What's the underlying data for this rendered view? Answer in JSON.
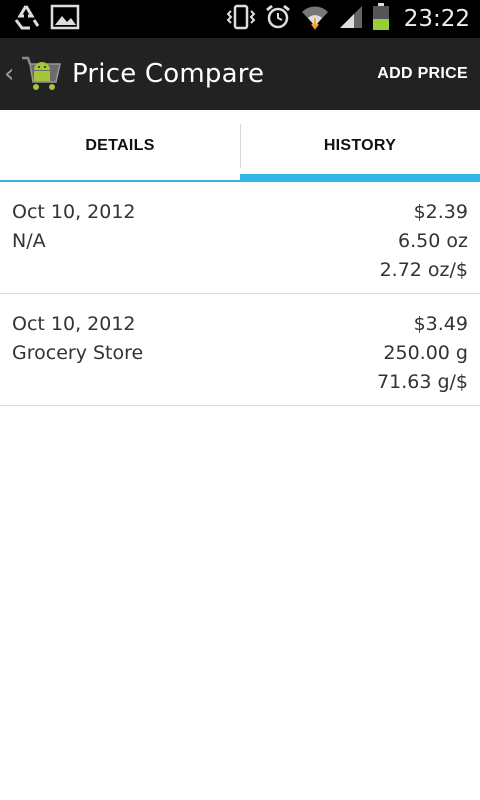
{
  "status_bar": {
    "time": "23:22",
    "icons": [
      "recycle-icon",
      "gallery-icon",
      "vibrate-icon",
      "alarm-icon",
      "wifi-icon",
      "signal-icon",
      "battery-icon"
    ]
  },
  "action_bar": {
    "title": "Price Compare",
    "action_label": "ADD PRICE"
  },
  "tabs": [
    {
      "label": "DETAILS",
      "selected": false
    },
    {
      "label": "HISTORY",
      "selected": true
    }
  ],
  "history": [
    {
      "date": "Oct 10, 2012",
      "store": "N/A",
      "price": "$2.39",
      "quantity": "6.50 oz",
      "unit_price": "2.72 oz/$"
    },
    {
      "date": "Oct 10, 2012",
      "store": "Grocery Store",
      "price": "$3.49",
      "quantity": "250.00 g",
      "unit_price": "71.63 g/$"
    }
  ],
  "colors": {
    "accent": "#33b5e5",
    "action_bar": "#222222",
    "status_bar": "#000000",
    "android_green": "#a4c639"
  }
}
